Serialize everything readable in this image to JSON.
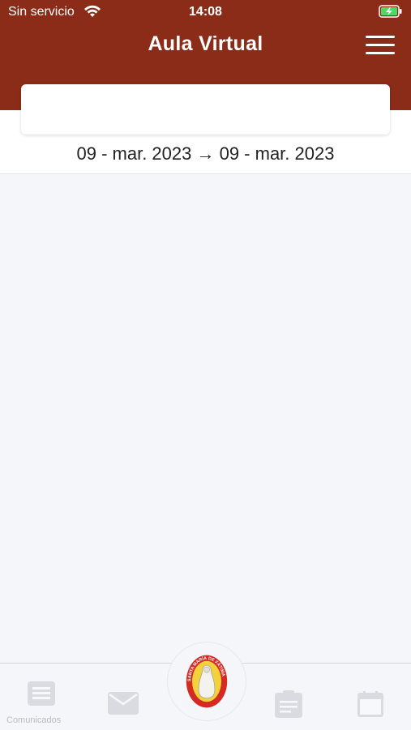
{
  "status": {
    "carrier": "Sin servicio",
    "time": "14:08",
    "wifi_icon": "wifi-icon",
    "battery_icon": "battery-charging-icon"
  },
  "header": {
    "title": "Aula Virtual",
    "menu_icon": "hamburger-menu-icon",
    "color": "#8a2c18"
  },
  "date_filter": {
    "range": "09 - mar. 2023 → 09 - mar. 2023"
  },
  "bottom_nav": {
    "items": [
      {
        "icon": "list-icon",
        "label": "Comunicados"
      },
      {
        "icon": "mail-icon"
      },
      {
        "icon": "school-logo"
      },
      {
        "icon": "clipboard-icon"
      },
      {
        "icon": "calendar-icon"
      }
    ],
    "logo_text": "SANTA MARÍA DE FÁTIMA"
  }
}
